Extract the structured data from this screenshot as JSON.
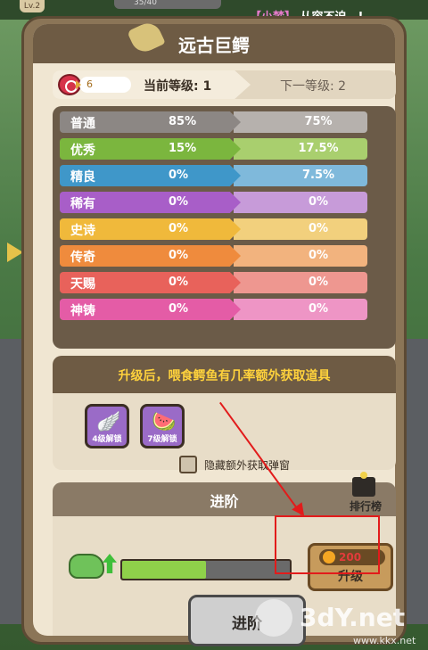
{
  "hud": {
    "level_badge": "Lv.2",
    "top_progress": "35/40",
    "chat_name": "【小梦】",
    "chat_message": "从容不迫，!"
  },
  "panel": {
    "title": "远古巨鳄"
  },
  "level": {
    "coin_count": "6",
    "current_label": "当前等级: 1",
    "next_label": "下一等级: 2"
  },
  "rates": [
    {
      "name": "普通",
      "current": "85%",
      "next": "75%",
      "color": "#8c8784",
      "next_color": "#b6b1ad"
    },
    {
      "name": "优秀",
      "current": "15%",
      "next": "17.5%",
      "color": "#7bb63e",
      "next_color": "#a9cf6e"
    },
    {
      "name": "精良",
      "current": "0%",
      "next": "7.5%",
      "color": "#3f97c9",
      "next_color": "#7fb9db"
    },
    {
      "name": "稀有",
      "current": "0%",
      "next": "0%",
      "color": "#a85ec8",
      "next_color": "#c79bd9"
    },
    {
      "name": "史诗",
      "current": "0%",
      "next": "0%",
      "color": "#f0b93b",
      "next_color": "#f2d07d"
    },
    {
      "name": "传奇",
      "current": "0%",
      "next": "0%",
      "color": "#ef8b3d",
      "next_color": "#f2b37e"
    },
    {
      "name": "天赐",
      "current": "0%",
      "next": "0%",
      "color": "#e8625b",
      "next_color": "#ee9790"
    },
    {
      "name": "神铸",
      "current": "0%",
      "next": "0%",
      "color": "#e45ca6",
      "next_color": "#ee95c5"
    }
  ],
  "upgrade_info": {
    "title": "升级后，喂食鳄鱼有几率额外获取道具",
    "items": [
      {
        "glyph": "🪽",
        "label": "4级解锁"
      },
      {
        "glyph": "🍉",
        "label": "7级解锁"
      }
    ],
    "checkbox_label": "隐藏额外获取弹窗"
  },
  "advance": {
    "title": "进阶",
    "rank_label": "排行榜",
    "progress": 0.5,
    "upgrade_cost": "200",
    "upgrade_label": "升级",
    "advance_button": "进阶"
  },
  "watermark": {
    "brand": "3dY.net",
    "sub": "www.kkx.net"
  }
}
